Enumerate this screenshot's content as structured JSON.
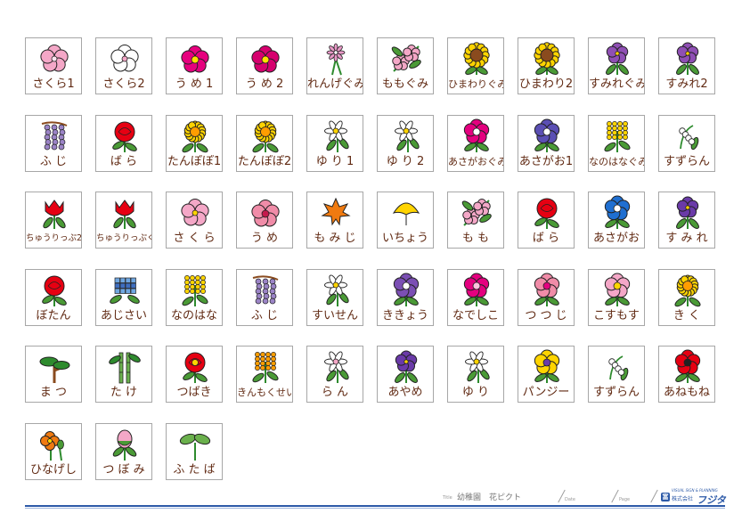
{
  "cards": [
    {
      "label": "さくら1",
      "icon": "cherry-blossom-icon",
      "color": "#f4a7c7",
      "accent": "#fce4ef"
    },
    {
      "label": "さくら2",
      "icon": "cherry-blossom-icon",
      "color": "#ffffff",
      "accent": "#f4a7c7"
    },
    {
      "label": "う め 1",
      "icon": "plum-blossom-icon",
      "color": "#e6007e",
      "accent": "#ffe100"
    },
    {
      "label": "う め 2",
      "icon": "plum-blossom-icon",
      "color": "#d6006e",
      "accent": "#ffe100"
    },
    {
      "label": "れんげぐみ",
      "icon": "milk-vetch-icon",
      "color": "#e899c7",
      "accent": "#ffffff"
    },
    {
      "label": "ももぐみ",
      "icon": "peach-blossom-icon",
      "color": "#f4a7c7",
      "accent": "#b45fa9"
    },
    {
      "label": "ひまわりぐみ",
      "icon": "sunflower-icon",
      "color": "#ffd400",
      "accent": "#8a4b1e"
    },
    {
      "label": "ひまわり2",
      "icon": "sunflower-icon",
      "color": "#ffd400",
      "accent": "#8a4b1e"
    },
    {
      "label": "すみれぐみ",
      "icon": "violet-icon",
      "color": "#8f4fb4",
      "accent": "#ffffff"
    },
    {
      "label": "すみれ2",
      "icon": "violet-icon",
      "color": "#8f4fb4",
      "accent": "#ffffff"
    },
    {
      "label": "ふ じ",
      "icon": "wisteria-icon",
      "color": "#9b84c6",
      "accent": "#ffffff"
    },
    {
      "label": "ば ら",
      "icon": "rose-icon",
      "color": "#e60012",
      "accent": "#b0000d"
    },
    {
      "label": "たんぽぽ1",
      "icon": "dandelion-icon",
      "color": "#ffd400",
      "accent": "#ff9d00"
    },
    {
      "label": "たんぽぽ2",
      "icon": "dandelion-icon",
      "color": "#ffd400",
      "accent": "#ff9d00"
    },
    {
      "label": "ゆ り 1",
      "icon": "lily-icon",
      "color": "#ffffff",
      "accent": "#ffd400"
    },
    {
      "label": "ゆ り 2",
      "icon": "lily-icon",
      "color": "#ffffff",
      "accent": "#ffd400"
    },
    {
      "label": "あさがおぐみ",
      "icon": "morning-glory-icon",
      "color": "#e4007f",
      "accent": "#ffffff"
    },
    {
      "label": "あさがお1",
      "icon": "morning-glory-icon",
      "color": "#5b4fb4",
      "accent": "#ffffff"
    },
    {
      "label": "なのはなぐみ",
      "icon": "rapeseed-icon",
      "color": "#ffd400",
      "accent": "#4a9a36"
    },
    {
      "label": "すずらん",
      "icon": "lily-of-the-valley-icon",
      "color": "#ffffff",
      "accent": "#4a9a36"
    },
    {
      "label": "ちゅうりっぷ2",
      "icon": "tulip-icon",
      "color": "#e60012",
      "accent": "#ff6b6b"
    },
    {
      "label": "ちゅうりっぷぐみ",
      "icon": "tulip-icon",
      "color": "#e60012",
      "accent": "#ff6b6b"
    },
    {
      "label": "さ く ら",
      "icon": "cherry-blossom-icon",
      "color": "#f4a7c7",
      "accent": "#ffd400"
    },
    {
      "label": "う め",
      "icon": "plum-blossom-icon",
      "color": "#f08ca8",
      "accent": "#c41a4c"
    },
    {
      "label": "も み じ",
      "icon": "maple-leaf-icon",
      "color": "#f07a10",
      "accent": "#e63a00"
    },
    {
      "label": "いちょう",
      "icon": "ginkgo-leaf-icon",
      "color": "#ffd400",
      "accent": "#e6b800"
    },
    {
      "label": "も も",
      "icon": "peach-blossom-icon",
      "color": "#f4a7c7",
      "accent": "#e87aa8"
    },
    {
      "label": "ば ら",
      "icon": "rose-icon",
      "color": "#e60012",
      "accent": "#b0000d"
    },
    {
      "label": "あさがお",
      "icon": "morning-glory-icon",
      "color": "#1f6fd1",
      "accent": "#ffffff"
    },
    {
      "label": "す み れ",
      "icon": "violet-icon",
      "color": "#6a3aa8",
      "accent": "#ffffff"
    },
    {
      "label": "ぼたん",
      "icon": "peony-icon",
      "color": "#e60012",
      "accent": "#ff7f7f"
    },
    {
      "label": "あじさい",
      "icon": "hydrangea-icon",
      "color": "#6fa6e0",
      "accent": "#3f6fc0"
    },
    {
      "label": "なのはな",
      "icon": "rapeseed-icon",
      "color": "#ffd400",
      "accent": "#4a9a36"
    },
    {
      "label": "ふ じ",
      "icon": "wisteria-icon",
      "color": "#9b84c6",
      "accent": "#ffffff"
    },
    {
      "label": "すいせん",
      "icon": "daffodil-icon",
      "color": "#ffffff",
      "accent": "#ffd400"
    },
    {
      "label": "ききょう",
      "icon": "bellflower-icon",
      "color": "#7b4fb4",
      "accent": "#ffffff"
    },
    {
      "label": "なでしこ",
      "icon": "pink-icon",
      "color": "#e4007f",
      "accent": "#ffc0df"
    },
    {
      "label": "つ つ じ",
      "icon": "azalea-icon",
      "color": "#f08ca8",
      "accent": "#e4007f"
    },
    {
      "label": "こすもす",
      "icon": "cosmos-icon",
      "color": "#f4a7c7",
      "accent": "#ffd400"
    },
    {
      "label": "き く",
      "icon": "chrysanthemum-icon",
      "color": "#ffd400",
      "accent": "#ff9d00"
    },
    {
      "label": "ま つ",
      "icon": "pine-icon",
      "color": "#2e8b2e",
      "accent": "#8a4b1e"
    },
    {
      "label": "た け",
      "icon": "bamboo-icon",
      "color": "#6ab04c",
      "accent": "#2e8b2e"
    },
    {
      "label": "つばき",
      "icon": "camellia-icon",
      "color": "#e60012",
      "accent": "#ffd400"
    },
    {
      "label": "きんもくせい",
      "icon": "osmanthus-icon",
      "color": "#ff9d00",
      "accent": "#2e6b2e"
    },
    {
      "label": "ら ん",
      "icon": "orchid-icon",
      "color": "#ffffff",
      "accent": "#f4a7c7"
    },
    {
      "label": "あやめ",
      "icon": "iris-icon",
      "color": "#6a3aa8",
      "accent": "#ffd400"
    },
    {
      "label": "ゆ り",
      "icon": "lily-icon",
      "color": "#ffffff",
      "accent": "#ffd400"
    },
    {
      "label": "パンジー",
      "icon": "pansy-icon",
      "color": "#ffd400",
      "accent": "#6a3aa8"
    },
    {
      "label": "すずらん",
      "icon": "lily-of-the-valley-icon",
      "color": "#ffffff",
      "accent": "#4a9a36"
    },
    {
      "label": "あねもね",
      "icon": "anemone-icon",
      "color": "#e60012",
      "accent": "#222222"
    },
    {
      "label": "ひなげし",
      "icon": "poppy-icon",
      "color": "#f07a10",
      "accent": "#ffd400"
    },
    {
      "label": "つ ぼ み",
      "icon": "flower-bud-icon",
      "color": "#f4a7c7",
      "accent": "#4a9a36"
    },
    {
      "label": "ふ た ば",
      "icon": "sprout-icon",
      "color": "#6ab04c",
      "accent": "#2e8b2e"
    }
  ],
  "footer": {
    "title_label": "Title",
    "title_value": "幼稚園　花ピクト",
    "date_label": "Date",
    "page_label": "Page",
    "logo_tagline": "VISUAL SIGN & PLANNING",
    "logo_corp": "株式会社",
    "logo_brand": "フジタ",
    "logo_mark": "富",
    "rule_color": "#2d5aa8"
  }
}
